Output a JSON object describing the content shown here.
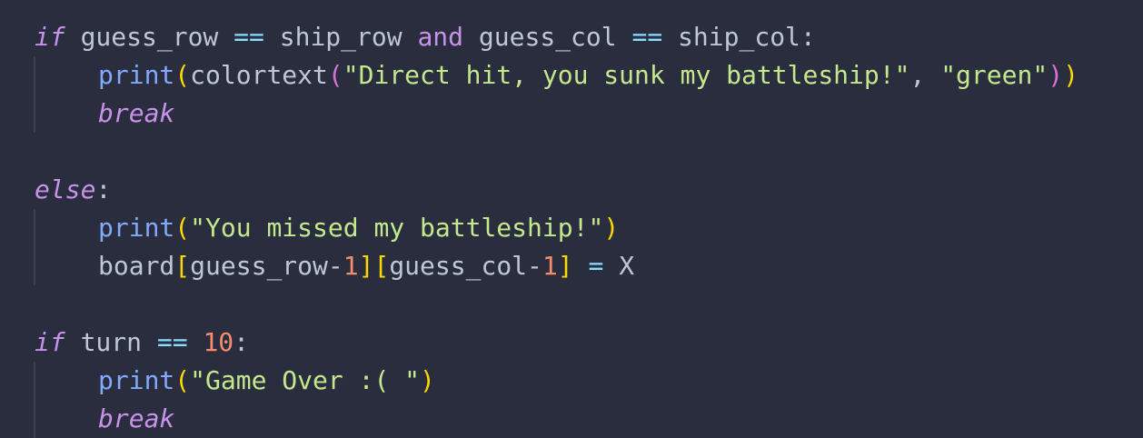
{
  "code": {
    "line1": {
      "if": "if",
      "a": " guess_row ",
      "eq": "==",
      "b": " ship_row ",
      "and": "and",
      "c": " guess_col ",
      "eq2": "==",
      "d": " ship_col:"
    },
    "line2": {
      "print": "print",
      "p1": "(",
      "colortext": "colortext",
      "p2": "(",
      "s1": "\"Direct hit, you sunk my battleship!\"",
      "comma": ", ",
      "s2": "\"green\"",
      "p3": ")",
      "p4": ")"
    },
    "line3": {
      "break": "break"
    },
    "line5": {
      "else": "else",
      "colon": ":"
    },
    "line6": {
      "print": "print",
      "p1": "(",
      "s1": "\"You missed my battleship!\"",
      "p2": ")"
    },
    "line7": {
      "board": "board",
      "b1": "[",
      "a": "guess_row-",
      "n1": "1",
      "b2": "]",
      "b3": "[",
      "c": "guess_col-",
      "n2": "1",
      "b4": "]",
      "eq": " = ",
      "x": "X"
    },
    "line9": {
      "if": "if",
      "a": " turn ",
      "eq": "==",
      "sp": " ",
      "n": "10",
      "colon": ":"
    },
    "line10": {
      "print": "print",
      "p1": "(",
      "s1": "\"Game Over :( \"",
      "p2": ")"
    },
    "line11": {
      "break": "break"
    }
  },
  "colors": {
    "background": "#292d3e",
    "keyword": "#c792ea",
    "function": "#82aaff",
    "string": "#c3e88d",
    "number": "#f78c6c",
    "operator": "#89ddff",
    "bracket": "#ffd700"
  }
}
